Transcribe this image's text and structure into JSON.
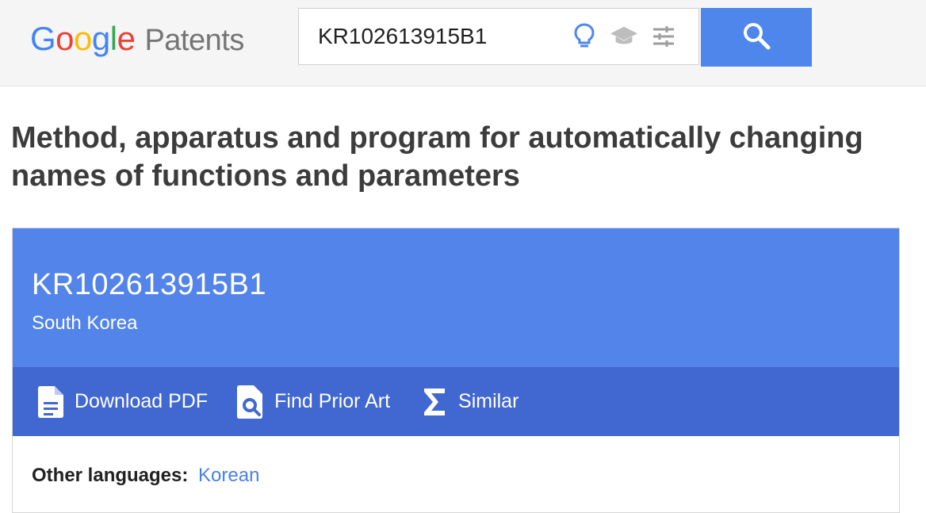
{
  "header": {
    "logo": {
      "google_letters": [
        "G",
        "o",
        "o",
        "g",
        "l",
        "e"
      ],
      "google_colors": [
        "#4285F4",
        "#EA4335",
        "#FBBC05",
        "#4285F4",
        "#34A853",
        "#EA4335"
      ],
      "product": "Patents"
    },
    "search": {
      "value": "KR102613915B1",
      "icons": [
        "lightbulb-icon",
        "scholar-cap-icon",
        "tune-icon"
      ],
      "button_icon": "search-icon"
    }
  },
  "patent": {
    "title": "Method, apparatus and program for automatically changing names of functions and parameters",
    "publication_number": "KR102613915B1",
    "country": "South Korea",
    "actions": [
      {
        "label": "Download PDF",
        "icon": "document-icon"
      },
      {
        "label": "Find Prior Art",
        "icon": "find-document-icon"
      },
      {
        "label": "Similar",
        "icon": "sigma-icon"
      }
    ],
    "other_languages_label": "Other languages:",
    "other_languages": [
      "Korean"
    ]
  },
  "colors": {
    "search_button": "#4f86ec",
    "card_header": "#5384ea",
    "action_bar": "#4168d1",
    "link": "#4a7fe8"
  }
}
